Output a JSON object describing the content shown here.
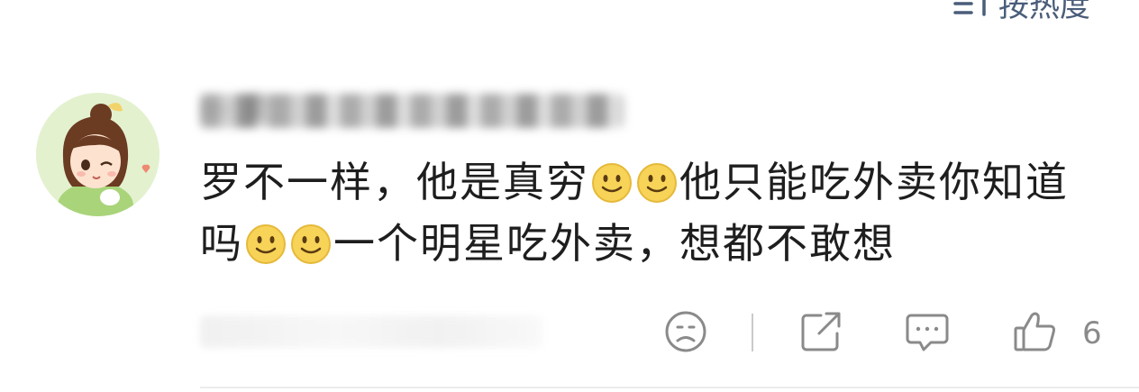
{
  "sort": {
    "label": "按热度",
    "icon": "sort-arrows-icon"
  },
  "comment": {
    "username": "··· 卖",
    "text_parts": [
      "罗不一样，他是真穷",
      "他只能吃外卖你知道吗",
      "一个明星吃外卖，想都不敢想"
    ],
    "emoji": "smile-emoji",
    "avatar": "avatar-girl-illustration"
  },
  "actions": {
    "dislike_icon": "sad-face-icon",
    "share_icon": "share-icon",
    "reply_icon": "reply-bubble-icon",
    "like_icon": "thumbs-up-icon",
    "like_count": "6"
  },
  "colors": {
    "text": "#1e1e1e",
    "icon": "#8a8a8a",
    "sort": "#4a5d7a",
    "emoji_fill": "#f7d358"
  }
}
